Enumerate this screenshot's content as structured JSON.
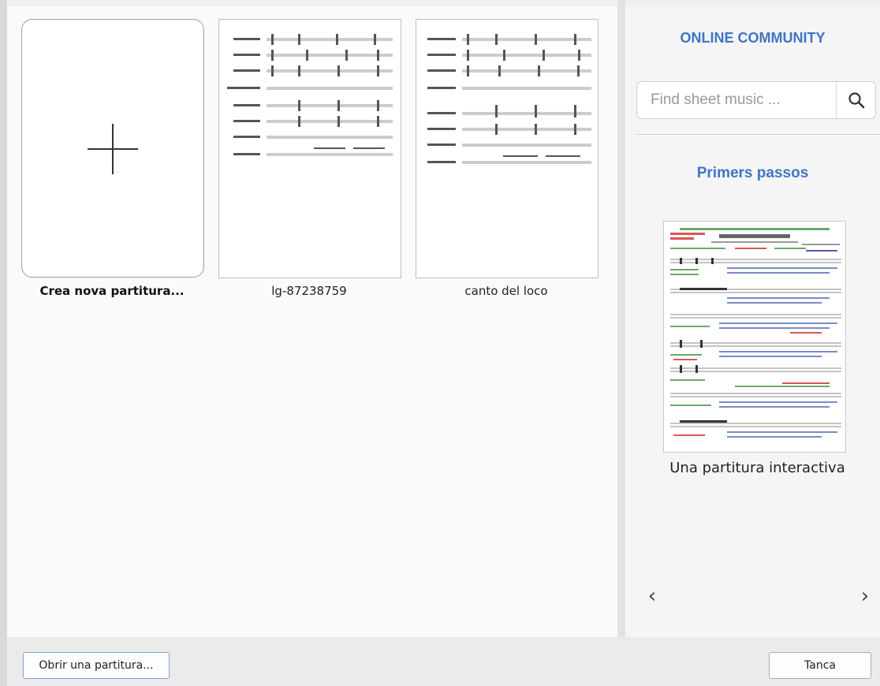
{
  "start_center": {
    "new_score_label": "Crea nova partitura...",
    "recent_scores": [
      {
        "label": "lg-87238759"
      },
      {
        "label": "canto del loco"
      }
    ]
  },
  "community": {
    "title": "ONLINE COMMUNITY",
    "search_placeholder": "Find sheet music ...",
    "search_icon": "search-icon",
    "section_title": "Primers passos",
    "featured_caption": "Una partitura interactiva",
    "prev_glyph": "‹",
    "next_glyph": "›"
  },
  "footer": {
    "open_button": "Obrir una partitura...",
    "close_button": "Tanca"
  },
  "colors": {
    "accent": "#3f75c4",
    "background": "#ebebeb"
  }
}
